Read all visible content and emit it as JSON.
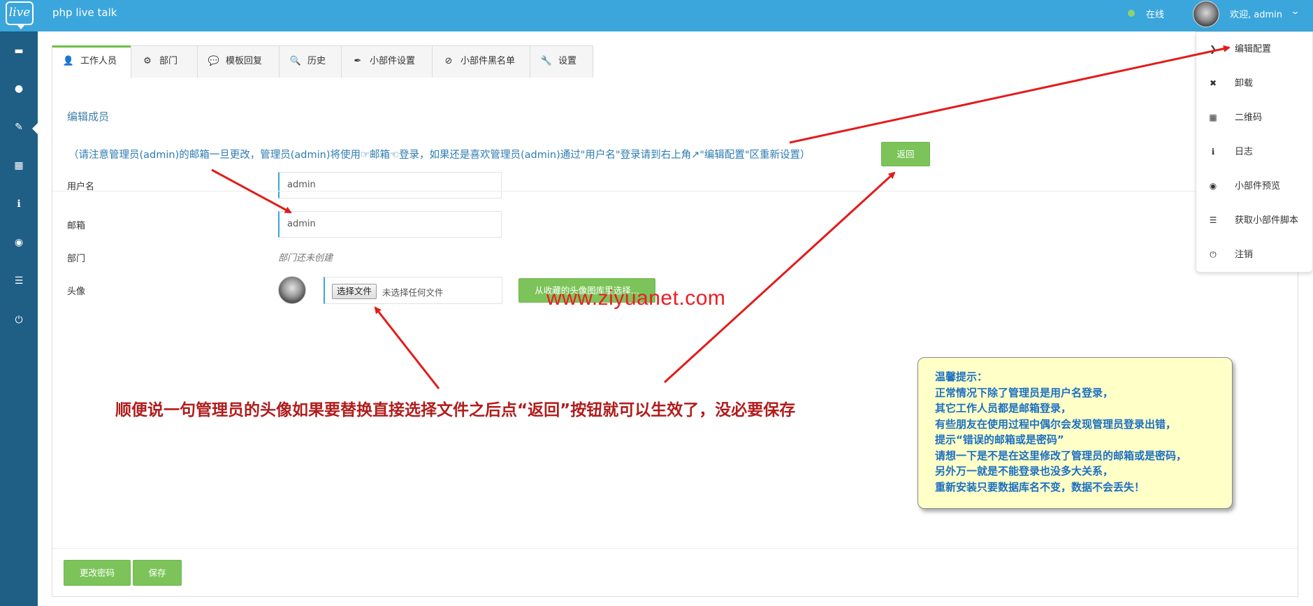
{
  "topbar": {
    "logo": "live",
    "title": "php live talk",
    "status": "在线",
    "welcome": "欢迎, admin"
  },
  "sidebar": {
    "items": [
      {
        "icon": "chat-icon",
        "glyph": "▬"
      },
      {
        "icon": "location-pin-icon",
        "glyph": "●"
      },
      {
        "icon": "wrench-icon",
        "glyph": "✎"
      },
      {
        "icon": "qrcode-icon",
        "glyph": "▦"
      },
      {
        "icon": "info-icon",
        "glyph": "ℹ"
      },
      {
        "icon": "eye-icon",
        "glyph": "◉"
      },
      {
        "icon": "align-left-icon",
        "glyph": "☰"
      },
      {
        "icon": "power-icon",
        "glyph": "⏻"
      }
    ]
  },
  "tabs": [
    {
      "label": "工作人员",
      "glyph": "👤"
    },
    {
      "label": "部门",
      "glyph": "⚙"
    },
    {
      "label": "模板回复",
      "glyph": "💬"
    },
    {
      "label": "历史",
      "glyph": "🔍"
    },
    {
      "label": "小部件设置",
      "glyph": "✒"
    },
    {
      "label": "小部件黑名单",
      "glyph": "⊘"
    },
    {
      "label": "设置",
      "glyph": "🔧"
    }
  ],
  "form": {
    "section_title": "编辑成员",
    "notice": "（请注意管理员(admin)的邮箱一旦更改，管理员(admin)将使用☞邮箱☜登录，如果还是喜欢管理员(admin)通过\"用户名\"登录请到右上角↗\"编辑配置\"区重新设置）",
    "back_button": "返回",
    "username_label": "用户名",
    "username_value": "admin",
    "email_label": "邮箱",
    "email_value": "admin",
    "dept_label": "部门",
    "dept_value": "部门还未创建",
    "avatar_label": "头像",
    "choose_file_button": "选择文件",
    "file_status": "未选择任何文件",
    "gallery_button": "从收藏的头像图库里选择..."
  },
  "footer_buttons": {
    "change_password": "更改密码",
    "save": "保存"
  },
  "dropdown": {
    "items": [
      {
        "label": "编辑配置",
        "icon": "chevron-right-icon",
        "glyph": "❯"
      },
      {
        "label": "卸载",
        "icon": "close-icon",
        "glyph": "✖"
      },
      {
        "label": "二维码",
        "icon": "qrcode-icon",
        "glyph": "▦"
      },
      {
        "label": "日志",
        "icon": "info-icon",
        "glyph": "ℹ"
      },
      {
        "label": "小部件预览",
        "icon": "eye-icon",
        "glyph": "◉"
      },
      {
        "label": "获取小部件脚本",
        "icon": "align-left-icon",
        "glyph": "☰"
      },
      {
        "label": "注销",
        "icon": "power-icon",
        "glyph": "⏻"
      }
    ]
  },
  "overlay": {
    "watermark": "www.ziyuanet.com",
    "annotation": "顺便说一句管理员的头像如果要替换直接选择文件之后点“返回”按钮就可以生效了，没必要保存",
    "tip_lines": [
      "温馨提示：",
      "正常情况下除了管理员是用户名登录，",
      "其它工作人员都是邮箱登录，",
      "有些朋友在使用过程中偶尔会发现管理员登录出错，",
      "提示“错误的邮箱或是密码”",
      "请想一下是不是在这里修改了管理员的邮箱或是密码，",
      "另外万一就是不能登录也没多大关系，",
      "重新安装只要数据库名不变，数据不会丢失！"
    ],
    "arrow_color": "#e31b1b"
  },
  "colors": {
    "topbar": "#3aa6dc",
    "sidebar": "#1f5e85",
    "accent_green": "#7cc45a",
    "link_blue": "#2d7cb0"
  }
}
